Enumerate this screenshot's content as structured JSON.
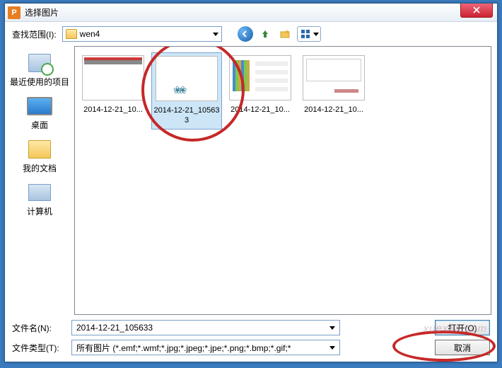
{
  "window": {
    "title": "选择图片"
  },
  "toolbar": {
    "look_in_label": "查找范围(I):",
    "current_folder": "wen4"
  },
  "nav_icons": {
    "back": "back-icon",
    "up": "up-one-level-icon",
    "new_folder": "new-folder-icon",
    "view": "view-menu-icon"
  },
  "places": [
    {
      "id": "recent",
      "label": "最近使用的项目"
    },
    {
      "id": "desktop",
      "label": "桌面"
    },
    {
      "id": "documents",
      "label": "我的文档"
    },
    {
      "id": "computer",
      "label": "计算机"
    }
  ],
  "files": [
    {
      "caption": "2014-12-21_10...",
      "selected": false
    },
    {
      "caption": "2014-12-21_105633",
      "selected": true
    },
    {
      "caption": "2014-12-21_10...",
      "selected": false
    },
    {
      "caption": "2014-12-21_10...",
      "selected": false
    }
  ],
  "bottom": {
    "filename_label": "文件名(N):",
    "filename_value": "2014-12-21_105633",
    "filetype_label": "文件类型(T):",
    "filetype_value": "所有图片 (*.emf;*.wmf;*.jpg;*.jpeg;*.jpe;*.png;*.bmp;*.gif;*",
    "open_label": "打开(O)",
    "cancel_label": "取消"
  },
  "watermark": "xuexila.com"
}
